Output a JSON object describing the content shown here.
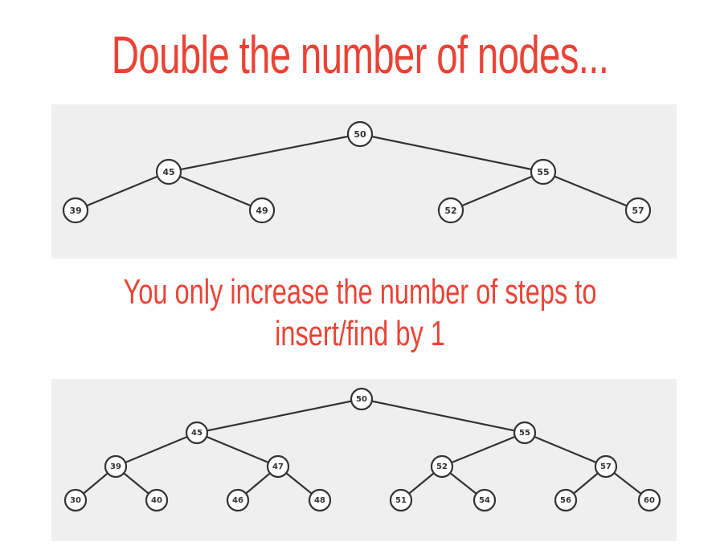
{
  "title": "Double the number of nodes...",
  "subtitle_lines": [
    "You only increase the number of steps to",
    "insert/find by 1"
  ],
  "colors": {
    "accent": "#ea4335",
    "panel_background": "#efefef",
    "node_stroke": "#333333",
    "node_fill": "#ffffff"
  },
  "trees": {
    "small": {
      "nodes": [
        "50",
        "45",
        "55",
        "39",
        "49",
        "52",
        "57"
      ],
      "edges": [
        [
          "50",
          "45"
        ],
        [
          "50",
          "55"
        ],
        [
          "45",
          "39"
        ],
        [
          "45",
          "49"
        ],
        [
          "55",
          "52"
        ],
        [
          "55",
          "57"
        ]
      ]
    },
    "large": {
      "nodes": [
        "50",
        "45",
        "55",
        "39",
        "47",
        "52",
        "57",
        "30",
        "40",
        "46",
        "48",
        "51",
        "54",
        "56",
        "60"
      ],
      "edges": [
        [
          "50",
          "45"
        ],
        [
          "50",
          "55"
        ],
        [
          "45",
          "39"
        ],
        [
          "45",
          "47"
        ],
        [
          "55",
          "52"
        ],
        [
          "55",
          "57"
        ],
        [
          "39",
          "30"
        ],
        [
          "39",
          "40"
        ],
        [
          "47",
          "46"
        ],
        [
          "47",
          "48"
        ],
        [
          "52",
          "51"
        ],
        [
          "52",
          "54"
        ],
        [
          "57",
          "56"
        ],
        [
          "57",
          "60"
        ]
      ]
    }
  }
}
